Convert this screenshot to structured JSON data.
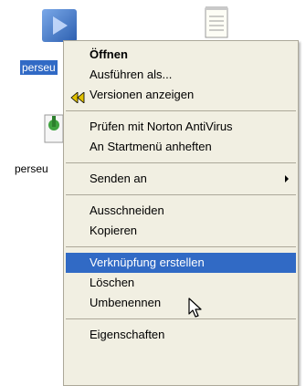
{
  "desktop": {
    "icon1_label": "perseu",
    "icon3_label": "perseu"
  },
  "menu": {
    "group1": [
      {
        "label": "Öffnen"
      },
      {
        "label": "Ausführen als..."
      },
      {
        "label": "Versionen anzeigen"
      }
    ],
    "group2": [
      {
        "label": "Prüfen mit Norton AntiVirus"
      },
      {
        "label": "An Startmenü anheften"
      }
    ],
    "group3": [
      {
        "label": "Senden an"
      }
    ],
    "group4": [
      {
        "label": "Ausschneiden"
      },
      {
        "label": "Kopieren"
      }
    ],
    "group5": [
      {
        "label": "Verknüpfung erstellen"
      },
      {
        "label": "Löschen"
      },
      {
        "label": "Umbenennen"
      }
    ],
    "group6": [
      {
        "label": "Eigenschaften"
      }
    ]
  },
  "colors": {
    "selection": "#316ac5",
    "menu_bg": "#f1efe2"
  }
}
